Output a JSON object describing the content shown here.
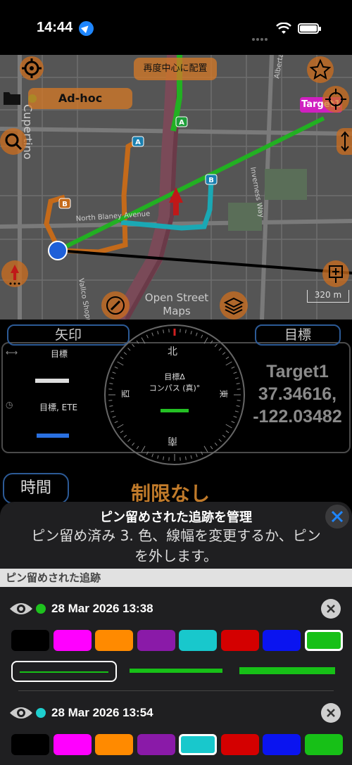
{
  "status": {
    "time": "14:44"
  },
  "map": {
    "recenter_label": "再度中心に配置",
    "track_name": "Ad-hoc",
    "target_tag": "Target1",
    "attribution": "Open Street Maps",
    "scale": "320 m",
    "street_labels": [
      "Cupertino",
      "North Blaney Avenue",
      "Inverness Way",
      "Alberta Avenue",
      "Vallco Shopping Mall"
    ],
    "waypoints": [
      "A",
      "A",
      "B",
      "B"
    ],
    "icons": [
      "gear-icon",
      "star-icon",
      "folder-icon",
      "search-icon",
      "crosshair-icon",
      "expand-vertical-icon",
      "compass-arrow-icon",
      "pin-add-icon",
      "edit-icon",
      "layers-icon"
    ]
  },
  "nav": {
    "arrow_tab": "矢印",
    "target_tab": "目標",
    "target_label": "目標",
    "target_value": "---",
    "eta_label": "目標, ETE",
    "eta_value": "---",
    "compass_north": "北",
    "compass_east": "東",
    "compass_south": "南",
    "compass_west": "西",
    "compass_caption1": "目標Δ",
    "compass_caption2": "コンパス (真)°",
    "compass_value": "---",
    "target_name": "Target1",
    "target_lat": "37.34616,",
    "target_lon": "-122.03482",
    "time_tab": "時間",
    "limit_text": "制限なし"
  },
  "sheet": {
    "title": "ピン留めされた追跡を管理",
    "description": "ピン留め済み 3. 色、線幅を変更するか、ピンを外します。",
    "section_header": "ピン留めされた追跡",
    "tracks": [
      {
        "date": "28 Mar 2026 13:38",
        "color": "#1ec21e",
        "selected_color_index": 7,
        "selected_width_index": 0
      },
      {
        "date": "28 Mar 2026 13:54",
        "color": "#1ecfcf",
        "selected_color_index": 4,
        "selected_width_index": 0
      }
    ],
    "palette": [
      "#000000",
      "#ff00ff",
      "#ff8a00",
      "#8a1aa8",
      "#18c8cc",
      "#d40000",
      "#0a14f0",
      "#17c017"
    ]
  }
}
